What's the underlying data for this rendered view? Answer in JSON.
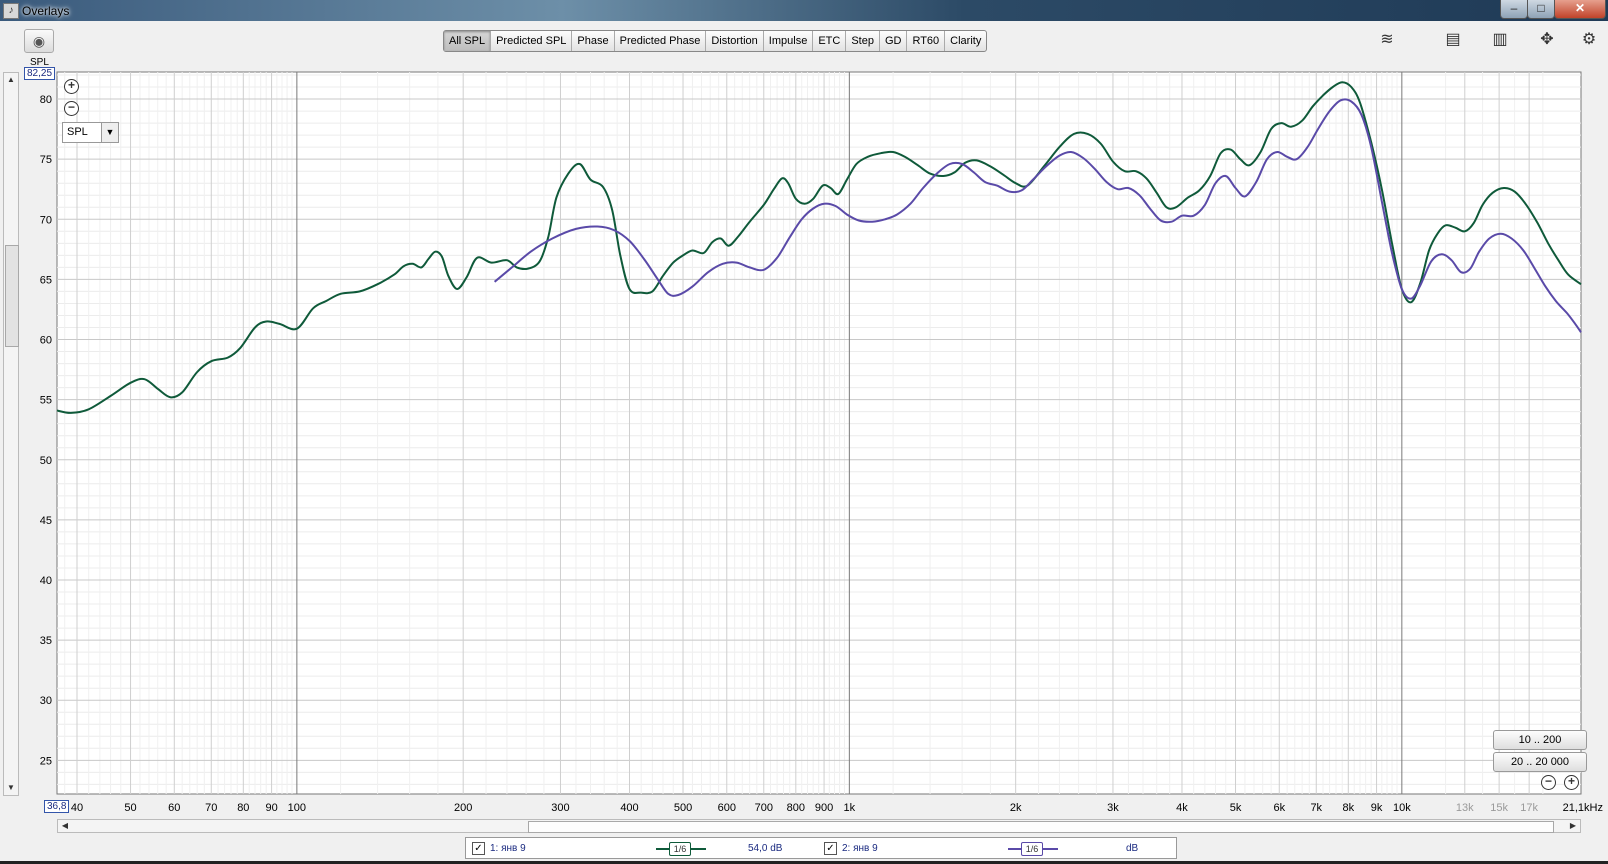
{
  "window": {
    "title": "Overlays"
  },
  "toolbar": {
    "tabs": [
      {
        "label": "All SPL",
        "active": true
      },
      {
        "label": "Predicted SPL",
        "active": false
      },
      {
        "label": "Phase",
        "active": false
      },
      {
        "label": "Predicted Phase",
        "active": false
      },
      {
        "label": "Distortion",
        "active": false
      },
      {
        "label": "Impulse",
        "active": false
      },
      {
        "label": "ETC",
        "active": false
      },
      {
        "label": "Step",
        "active": false
      },
      {
        "label": "GD",
        "active": false
      },
      {
        "label": "RT60",
        "active": false
      },
      {
        "label": "Clarity",
        "active": false
      }
    ]
  },
  "axis_panel": {
    "y_caption": "SPL",
    "y_readout": "82,25",
    "x_readout": "36,8",
    "dropdown_value": "SPL",
    "range_buttons": [
      "10 .. 200",
      "20 .. 20 000"
    ]
  },
  "legend": {
    "items": [
      {
        "checked": true,
        "name": "1: янв 9",
        "smoothing": "1/6",
        "level": "54,0 dB",
        "color": "#0f5a3a"
      },
      {
        "checked": true,
        "name": "2: янв 9",
        "smoothing": "1/6",
        "level": "dB",
        "color": "#5a4aa8"
      }
    ]
  },
  "chart_data": {
    "type": "line",
    "x_scale": "log",
    "xlim": [
      36.8,
      21100
    ],
    "ylim": [
      22.2,
      82.25
    ],
    "y_ticks": [
      25,
      30,
      35,
      40,
      45,
      50,
      55,
      60,
      65,
      70,
      75,
      80
    ],
    "x_ticks": [
      {
        "v": 40,
        "label": "40"
      },
      {
        "v": 50,
        "label": "50"
      },
      {
        "v": 60,
        "label": "60"
      },
      {
        "v": 70,
        "label": "70"
      },
      {
        "v": 80,
        "label": "80"
      },
      {
        "v": 90,
        "label": "90"
      },
      {
        "v": 100,
        "label": "100"
      },
      {
        "v": 200,
        "label": "200"
      },
      {
        "v": 300,
        "label": "300"
      },
      {
        "v": 400,
        "label": "400"
      },
      {
        "v": 500,
        "label": "500"
      },
      {
        "v": 600,
        "label": "600"
      },
      {
        "v": 700,
        "label": "700"
      },
      {
        "v": 800,
        "label": "800"
      },
      {
        "v": 900,
        "label": "900"
      },
      {
        "v": 1000,
        "label": "1k"
      },
      {
        "v": 2000,
        "label": "2k"
      },
      {
        "v": 3000,
        "label": "3k"
      },
      {
        "v": 4000,
        "label": "4k"
      },
      {
        "v": 5000,
        "label": "5k"
      },
      {
        "v": 6000,
        "label": "6k"
      },
      {
        "v": 7000,
        "label": "7k"
      },
      {
        "v": 8000,
        "label": "8k"
      },
      {
        "v": 9000,
        "label": "9k"
      },
      {
        "v": 10000,
        "label": "10k"
      },
      {
        "v": 13000,
        "label": "13k",
        "faint": true
      },
      {
        "v": 15000,
        "label": "15k",
        "faint": true
      },
      {
        "v": 17000,
        "label": "17k",
        "faint": true
      },
      {
        "v": 21100,
        "label": "21,1kHz"
      }
    ],
    "grid": true,
    "series": [
      {
        "name": "1: янв 9",
        "color": "#0f5a3a",
        "points": [
          [
            36.8,
            54.1
          ],
          [
            39,
            53.9
          ],
          [
            42,
            54.2
          ],
          [
            46,
            55.3
          ],
          [
            50,
            56.4
          ],
          [
            53,
            56.7
          ],
          [
            56,
            55.9
          ],
          [
            59,
            55.2
          ],
          [
            62,
            55.6
          ],
          [
            66,
            57.3
          ],
          [
            70,
            58.2
          ],
          [
            75,
            58.5
          ],
          [
            79,
            59.3
          ],
          [
            84,
            61.0
          ],
          [
            88,
            61.5
          ],
          [
            93,
            61.3
          ],
          [
            100,
            60.9
          ],
          [
            107,
            62.6
          ],
          [
            113,
            63.2
          ],
          [
            120,
            63.8
          ],
          [
            130,
            64.0
          ],
          [
            140,
            64.6
          ],
          [
            150,
            65.4
          ],
          [
            156,
            66.1
          ],
          [
            162,
            66.3
          ],
          [
            168,
            66.0
          ],
          [
            173,
            66.7
          ],
          [
            178,
            67.3
          ],
          [
            183,
            66.9
          ],
          [
            188,
            65.3
          ],
          [
            195,
            64.2
          ],
          [
            203,
            65.2
          ],
          [
            212,
            66.8
          ],
          [
            225,
            66.4
          ],
          [
            240,
            66.6
          ],
          [
            250,
            66.0
          ],
          [
            262,
            65.9
          ],
          [
            275,
            66.5
          ],
          [
            285,
            68.5
          ],
          [
            295,
            71.8
          ],
          [
            310,
            73.8
          ],
          [
            325,
            74.6
          ],
          [
            340,
            73.3
          ],
          [
            358,
            72.7
          ],
          [
            372,
            70.8
          ],
          [
            385,
            67.0
          ],
          [
            400,
            64.2
          ],
          [
            420,
            63.9
          ],
          [
            440,
            64.0
          ],
          [
            460,
            65.3
          ],
          [
            480,
            66.4
          ],
          [
            500,
            67.0
          ],
          [
            520,
            67.4
          ],
          [
            545,
            67.2
          ],
          [
            565,
            68.1
          ],
          [
            585,
            68.4
          ],
          [
            605,
            67.8
          ],
          [
            630,
            68.6
          ],
          [
            660,
            69.8
          ],
          [
            700,
            71.2
          ],
          [
            730,
            72.5
          ],
          [
            755,
            73.4
          ],
          [
            775,
            73.0
          ],
          [
            800,
            71.7
          ],
          [
            830,
            71.3
          ],
          [
            860,
            71.7
          ],
          [
            895,
            72.8
          ],
          [
            925,
            72.6
          ],
          [
            955,
            72.1
          ],
          [
            990,
            73.3
          ],
          [
            1030,
            74.6
          ],
          [
            1080,
            75.2
          ],
          [
            1140,
            75.5
          ],
          [
            1200,
            75.6
          ],
          [
            1260,
            75.2
          ],
          [
            1330,
            74.5
          ],
          [
            1400,
            73.8
          ],
          [
            1480,
            73.6
          ],
          [
            1550,
            73.9
          ],
          [
            1620,
            74.7
          ],
          [
            1700,
            74.9
          ],
          [
            1800,
            74.4
          ],
          [
            1900,
            73.7
          ],
          [
            2000,
            73.0
          ],
          [
            2100,
            72.8
          ],
          [
            2250,
            74.4
          ],
          [
            2400,
            76.0
          ],
          [
            2550,
            77.1
          ],
          [
            2700,
            77.1
          ],
          [
            2850,
            76.3
          ],
          [
            3000,
            74.8
          ],
          [
            3150,
            74.0
          ],
          [
            3300,
            74.0
          ],
          [
            3450,
            73.4
          ],
          [
            3600,
            72.2
          ],
          [
            3750,
            71.0
          ],
          [
            3900,
            71.0
          ],
          [
            4100,
            71.8
          ],
          [
            4300,
            72.4
          ],
          [
            4500,
            73.6
          ],
          [
            4700,
            75.5
          ],
          [
            4900,
            75.8
          ],
          [
            5100,
            75.0
          ],
          [
            5300,
            74.5
          ],
          [
            5550,
            75.6
          ],
          [
            5800,
            77.5
          ],
          [
            6050,
            78.0
          ],
          [
            6300,
            77.7
          ],
          [
            6600,
            78.2
          ],
          [
            6900,
            79.4
          ],
          [
            7200,
            80.3
          ],
          [
            7500,
            81.0
          ],
          [
            7800,
            81.4
          ],
          [
            8100,
            81.0
          ],
          [
            8400,
            79.7
          ],
          [
            8800,
            76.4
          ],
          [
            9200,
            72.5
          ],
          [
            9600,
            68.0
          ],
          [
            10000,
            64.2
          ],
          [
            10400,
            63.1
          ],
          [
            10800,
            64.7
          ],
          [
            11200,
            67.4
          ],
          [
            11600,
            68.8
          ],
          [
            12000,
            69.5
          ],
          [
            12500,
            69.3
          ],
          [
            13000,
            69.0
          ],
          [
            13500,
            69.7
          ],
          [
            14000,
            71.2
          ],
          [
            14600,
            72.2
          ],
          [
            15300,
            72.6
          ],
          [
            16000,
            72.3
          ],
          [
            16800,
            71.2
          ],
          [
            17600,
            69.7
          ],
          [
            18400,
            68.0
          ],
          [
            19200,
            66.6
          ],
          [
            20000,
            65.4
          ],
          [
            21100,
            64.6
          ]
        ]
      },
      {
        "name": "2: янв 9",
        "color": "#5a4aa8",
        "points": [
          [
            228,
            64.8
          ],
          [
            245,
            66.0
          ],
          [
            265,
            67.3
          ],
          [
            290,
            68.4
          ],
          [
            320,
            69.2
          ],
          [
            350,
            69.4
          ],
          [
            375,
            69.1
          ],
          [
            400,
            68.2
          ],
          [
            425,
            66.7
          ],
          [
            450,
            65.0
          ],
          [
            470,
            63.8
          ],
          [
            490,
            63.7
          ],
          [
            520,
            64.4
          ],
          [
            555,
            65.6
          ],
          [
            590,
            66.3
          ],
          [
            625,
            66.4
          ],
          [
            660,
            66.0
          ],
          [
            700,
            65.8
          ],
          [
            740,
            66.8
          ],
          [
            780,
            68.5
          ],
          [
            820,
            70.0
          ],
          [
            860,
            70.9
          ],
          [
            900,
            71.3
          ],
          [
            945,
            71.1
          ],
          [
            990,
            70.4
          ],
          [
            1040,
            69.9
          ],
          [
            1100,
            69.8
          ],
          [
            1160,
            70.0
          ],
          [
            1220,
            70.4
          ],
          [
            1290,
            71.3
          ],
          [
            1360,
            72.6
          ],
          [
            1440,
            73.8
          ],
          [
            1520,
            74.6
          ],
          [
            1600,
            74.6
          ],
          [
            1680,
            73.9
          ],
          [
            1760,
            73.1
          ],
          [
            1850,
            72.8
          ],
          [
            1950,
            72.3
          ],
          [
            2050,
            72.4
          ],
          [
            2150,
            73.3
          ],
          [
            2270,
            74.4
          ],
          [
            2400,
            75.3
          ],
          [
            2520,
            75.6
          ],
          [
            2650,
            75.1
          ],
          [
            2780,
            74.2
          ],
          [
            2920,
            73.1
          ],
          [
            3060,
            72.5
          ],
          [
            3200,
            72.6
          ],
          [
            3350,
            72.0
          ],
          [
            3500,
            70.9
          ],
          [
            3660,
            69.9
          ],
          [
            3830,
            69.8
          ],
          [
            4000,
            70.3
          ],
          [
            4200,
            70.3
          ],
          [
            4400,
            71.2
          ],
          [
            4600,
            73.0
          ],
          [
            4800,
            73.6
          ],
          [
            5000,
            72.6
          ],
          [
            5200,
            71.9
          ],
          [
            5450,
            73.1
          ],
          [
            5700,
            75.0
          ],
          [
            5950,
            75.6
          ],
          [
            6200,
            75.2
          ],
          [
            6450,
            75.0
          ],
          [
            6750,
            76.0
          ],
          [
            7050,
            77.5
          ],
          [
            7400,
            79.0
          ],
          [
            7750,
            79.9
          ],
          [
            8100,
            79.8
          ],
          [
            8450,
            78.7
          ],
          [
            8800,
            76.0
          ],
          [
            9200,
            71.5
          ],
          [
            9600,
            67.2
          ],
          [
            10000,
            64.2
          ],
          [
            10400,
            63.4
          ],
          [
            10800,
            64.5
          ],
          [
            11300,
            66.5
          ],
          [
            11800,
            67.1
          ],
          [
            12300,
            66.6
          ],
          [
            12800,
            65.6
          ],
          [
            13300,
            65.9
          ],
          [
            13800,
            67.3
          ],
          [
            14400,
            68.4
          ],
          [
            15100,
            68.8
          ],
          [
            15800,
            68.4
          ],
          [
            16600,
            67.4
          ],
          [
            17400,
            65.9
          ],
          [
            18200,
            64.4
          ],
          [
            19000,
            63.2
          ],
          [
            19900,
            62.2
          ],
          [
            20600,
            61.3
          ],
          [
            21100,
            60.6
          ]
        ]
      }
    ]
  }
}
